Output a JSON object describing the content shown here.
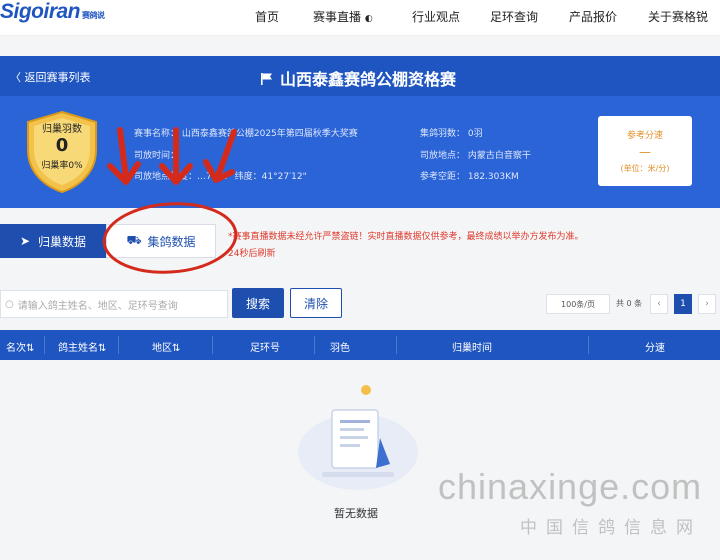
{
  "logo": {
    "text": "Sigoiran",
    "sub": "赛鸽说"
  },
  "nav": {
    "items": [
      "首页",
      "赛事直播",
      "行业观点",
      "足环查询",
      "产品报价",
      "关于赛格锐"
    ]
  },
  "titlebar": {
    "back": "〈 返回赛事列表",
    "title": "山西泰鑫赛鸽公棚资格赛"
  },
  "stats": {
    "returned_label": "归巢羽数",
    "returned_value": "0",
    "rate_label": "归巢率0%"
  },
  "info": {
    "race_name": "赛事名称： 山西泰鑫赛鸽公棚2025年第四届秋季大奖赛",
    "release_time": "司放时间：",
    "release_coords": "司放地点经度：…7°28\"   纬度：41°27′12\"",
    "collect_count": "集鸽羽数：   0羽",
    "release_place": "司放地点：   内蒙古白音察干",
    "ref_distance": "参考空距：   182.303KM"
  },
  "ref_card": {
    "label": "参考分速",
    "value": "—",
    "unit": "(单位：米/分)"
  },
  "tabs": {
    "returned": "归巢数据",
    "collect": "集鸽数据"
  },
  "notice": {
    "line1": "*赛事直播数据未经允许严禁盗链！实时直播数据仅供参考，最终成绩以举办方发布为准。",
    "line2": "24秒后刷新"
  },
  "search": {
    "placeholder": "请输入鸽主姓名、地区、足环号查询",
    "search_label": "搜索",
    "clear_label": "清除"
  },
  "pagination": {
    "page_size": "100条/页",
    "total": "共 0 条",
    "prev": "‹",
    "current": "1",
    "next": "›"
  },
  "table": {
    "columns": [
      "名次⇅",
      "鸽主姓名⇅",
      "地区⇅",
      "足环号",
      "羽色",
      "归巢时间",
      "分速"
    ]
  },
  "empty": {
    "text": "暂无数据"
  },
  "watermark": {
    "main": "chinaxinge.com",
    "sub": "中国信鸽信息网"
  },
  "colors": {
    "primary": "#1f55c0",
    "panel": "#2a64d6",
    "accent": "#e03a2c",
    "gold": "#e0902a"
  }
}
